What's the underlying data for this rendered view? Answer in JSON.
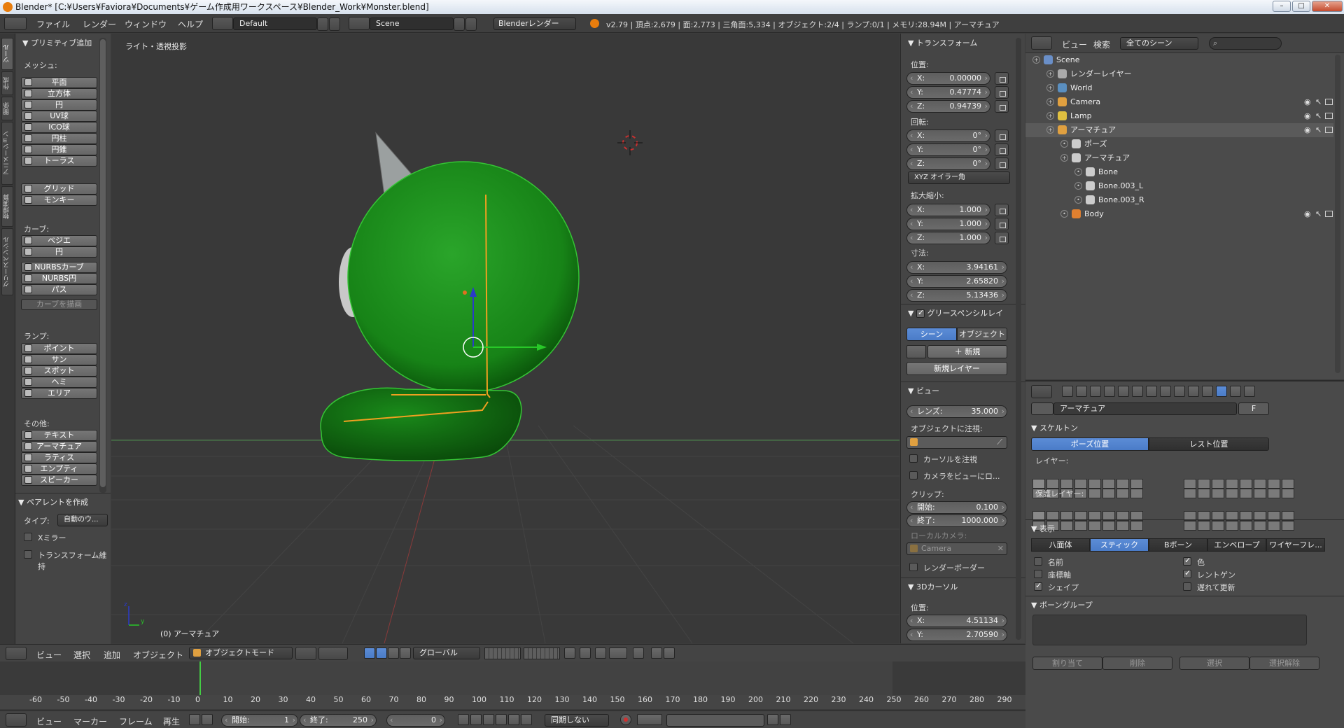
{
  "titlebar": {
    "text": "Blender* [C:¥Users¥Faviora¥Documents¥ゲーム作成用ワークスペース¥Blender_Work¥Monster.blend]"
  },
  "info": {
    "menus": [
      "ファイル",
      "レンダー",
      "ウィンドウ",
      "ヘルプ"
    ],
    "layout": "Default",
    "scene": "Scene",
    "engine": "Blenderレンダー",
    "stats": "v2.79 | 頂点:2,679 | 面:2,773 | 三角面:5,334 | オブジェクト:2/4 | ランプ:0/1 | メモリ:28.94M | アーマチュア"
  },
  "tabs": [
    "ツール",
    "作成",
    "関係",
    "アニメーション",
    "物理演算",
    "グリースペンシル"
  ],
  "toolshelf": {
    "title": "プリミティブ追加",
    "mesh_label": "メッシュ:",
    "mesh": [
      "平面",
      "立方体",
      "円",
      "UV球",
      "ICO球",
      "円柱",
      "円錐",
      "トーラス"
    ],
    "mesh2": [
      "グリッド",
      "モンキー"
    ],
    "curve_label": "カーブ:",
    "curve": [
      "ベジエ",
      "円"
    ],
    "curve2": [
      "NURBSカーブ",
      "NURBS円",
      "パス"
    ],
    "draw_curve": "カーブを描画",
    "lamp_label": "ランプ:",
    "lamp": [
      "ポイント",
      "サン",
      "スポット",
      "ヘミ",
      "エリア"
    ],
    "other_label": "その他:",
    "other": [
      "テキスト",
      "アーマチュア",
      "ラティス",
      "エンプティ",
      "スピーカー"
    ],
    "parent_title": "ペアレントを作成",
    "type_label": "タイプ:",
    "type_value": "自動のウ...",
    "xmirror": "Xミラー",
    "keep_transform": "トランスフォーム維持"
  },
  "viewport": {
    "label": "ライト・透視投影",
    "object_label": "(0) アーマチュア"
  },
  "npanel": {
    "transform_title": "トランスフォーム",
    "loc_label": "位置:",
    "loc": [
      {
        "a": "X:",
        "v": "0.00000"
      },
      {
        "a": "Y:",
        "v": "0.47774"
      },
      {
        "a": "Z:",
        "v": "0.94739"
      }
    ],
    "rot_label": "回転:",
    "rot": [
      {
        "a": "X:",
        "v": "0°"
      },
      {
        "a": "Y:",
        "v": "0°"
      },
      {
        "a": "Z:",
        "v": "0°"
      }
    ],
    "rot_mode": "XYZ オイラー角",
    "scale_label": "拡大縮小:",
    "scale": [
      {
        "a": "X:",
        "v": "1.000"
      },
      {
        "a": "Y:",
        "v": "1.000"
      },
      {
        "a": "Z:",
        "v": "1.000"
      }
    ],
    "dim_label": "寸法:",
    "dim": [
      {
        "a": "X:",
        "v": "3.94161"
      },
      {
        "a": "Y:",
        "v": "2.65820"
      },
      {
        "a": "Z:",
        "v": "5.13436"
      }
    ],
    "gp_title": "グリースペンシルレイ",
    "gp_scene": "シーン",
    "gp_object": "オブジェクト",
    "gp_new": "新規",
    "gp_newlayer": "新規レイヤー",
    "view_title": "ビュー",
    "lens_label": "レンズ:",
    "lens": "35.000",
    "lock_obj": "オブジェクトに注視:",
    "lock_cursor": "カーソルを注視",
    "cam_to_view": "カメラをビューにロ...",
    "clip_label": "クリップ:",
    "clip_start_label": "開始:",
    "clip_start": "0.100",
    "clip_end_label": "終了:",
    "clip_end": "1000.000",
    "local_cam": "ローカルカメラ:",
    "camera": "Camera",
    "render_border": "レンダーボーダー",
    "cursor_title": "3Dカーソル",
    "cursor_loc": "位置:",
    "cursor": [
      {
        "a": "X:",
        "v": "4.51134"
      },
      {
        "a": "Y:",
        "v": "2.70590"
      }
    ]
  },
  "outliner": {
    "menus": [
      "ビュー",
      "検索"
    ],
    "filter": "全てのシーン",
    "items": [
      {
        "t": "Scene",
        "d": 0,
        "c": "#6a8fc8"
      },
      {
        "t": "レンダーレイヤー",
        "d": 1,
        "c": "#aaa"
      },
      {
        "t": "World",
        "d": 1,
        "c": "#5a8fc0"
      },
      {
        "t": "Camera",
        "d": 1,
        "c": "#e0a040"
      },
      {
        "t": "Lamp",
        "d": 1,
        "c": "#e0c040"
      },
      {
        "t": "アーマチュア",
        "d": 1,
        "c": "#e0a040",
        "sel": true
      },
      {
        "t": "ポーズ",
        "d": 2,
        "c": "#ccc"
      },
      {
        "t": "アーマチュア",
        "d": 2,
        "c": "#ccc"
      },
      {
        "t": "Bone",
        "d": 3,
        "c": "#ccc"
      },
      {
        "t": "Bone.003_L",
        "d": 3,
        "c": "#ccc"
      },
      {
        "t": "Bone.003_R",
        "d": 3,
        "c": "#ccc"
      },
      {
        "t": "Body",
        "d": 2,
        "c": "#e08030"
      }
    ]
  },
  "props": {
    "name": "アーマチュア",
    "f": "F",
    "skeleton": "スケルトン",
    "pose_pos": "ポーズ位置",
    "rest_pos": "レスト位置",
    "layers": "レイヤー:",
    "protected": "保護レイヤー:",
    "display": "表示",
    "display_modes": [
      "八面体",
      "スティック",
      "Bボーン",
      "エンベロープ",
      "ワイヤーフレ..."
    ],
    "names": "名前",
    "color": "色",
    "axes": "座標軸",
    "xray": "レントゲン",
    "shapes": "シェイプ",
    "delay": "遅れて更新",
    "bone_groups": "ボーングループ",
    "assign": "割り当て",
    "remove": "削除",
    "select": "選択",
    "deselect": "選択解除"
  },
  "vphdr": {
    "menus": [
      "ビュー",
      "選択",
      "追加",
      "オブジェクト"
    ],
    "mode": "オブジェクトモード",
    "orientation": "グローバル"
  },
  "timeline": {
    "ticks": [
      "-60",
      "-50",
      "-40",
      "-30",
      "-20",
      "-10",
      "0",
      "10",
      "20",
      "30",
      "40",
      "50",
      "60",
      "70",
      "80",
      "90",
      "100",
      "110",
      "120",
      "130",
      "140",
      "150",
      "160",
      "170",
      "180",
      "190",
      "200",
      "210",
      "220",
      "230",
      "240",
      "250",
      "260",
      "270",
      "280",
      "290"
    ],
    "menus": [
      "ビュー",
      "マーカー",
      "フレーム",
      "再生"
    ],
    "start_label": "開始:",
    "start": "1",
    "end_label": "終了:",
    "end": "250",
    "current": "0",
    "sync": "同期しない"
  }
}
